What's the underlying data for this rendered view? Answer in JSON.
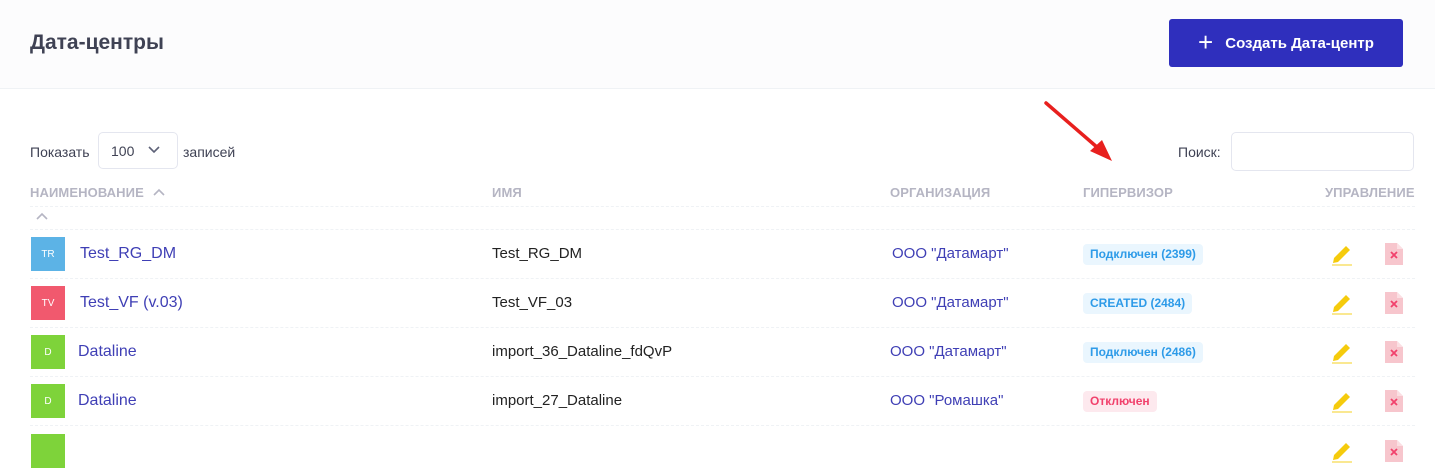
{
  "header": {
    "title": "Дата-центры",
    "create_button_label": "Создать Дата-центр"
  },
  "controls": {
    "show_label": "Показать",
    "page_size": "100",
    "records_label": "записей",
    "search_label": "Поиск:",
    "search_value": ""
  },
  "table": {
    "columns": [
      "НАИМЕНОВАНИЕ",
      "ИМЯ",
      "ОРГАНИЗАЦИЯ",
      "ГИПЕРВИЗОР",
      "УПРАВЛЕНИЕ"
    ],
    "rows": [
      {
        "avatar": "TR",
        "avatar_color": "#5cb3e6",
        "title": "Test_RG_DM",
        "name": "Test_RG_DM",
        "organization": "ООО \"Датамарт\"",
        "hypervisor": "Подключен (2399)",
        "status": "info"
      },
      {
        "avatar": "TV",
        "avatar_color": "#f1596e",
        "title": "Test_VF (v.03)",
        "name": "Test_VF_03",
        "organization": "ООО \"Датамарт\"",
        "hypervisor": "CREATED (2484)",
        "status": "info"
      },
      {
        "avatar": "D",
        "avatar_color": "#7ed33a",
        "title": "Dataline",
        "name": "import_36_Dataline_fdQvP",
        "organization": "ООО \"Датамарт\"",
        "hypervisor": "Подключен (2486)",
        "status": "info"
      },
      {
        "avatar": "D",
        "avatar_color": "#7ed33a",
        "title": "Dataline",
        "name": "import_27_Dataline",
        "organization": "ООО \"Ромашка\"",
        "hypervisor": "Отключен",
        "status": "danger"
      },
      {
        "avatar": "",
        "avatar_color": "#7ed33a",
        "title": "",
        "name": "",
        "organization": "",
        "hypervisor": "",
        "status": "none"
      }
    ]
  },
  "colors": {
    "accent": "#2f2fbd",
    "link": "#3f3fb5",
    "info_bg": "#eaf6fe",
    "info_text": "#2e9be8",
    "danger_bg": "#fde9ee",
    "danger_text": "#f1416c",
    "edit_icon": "#f5cb0c",
    "delete_icon": "#f7c6cd",
    "annotation_arrow": "#e8201e"
  }
}
